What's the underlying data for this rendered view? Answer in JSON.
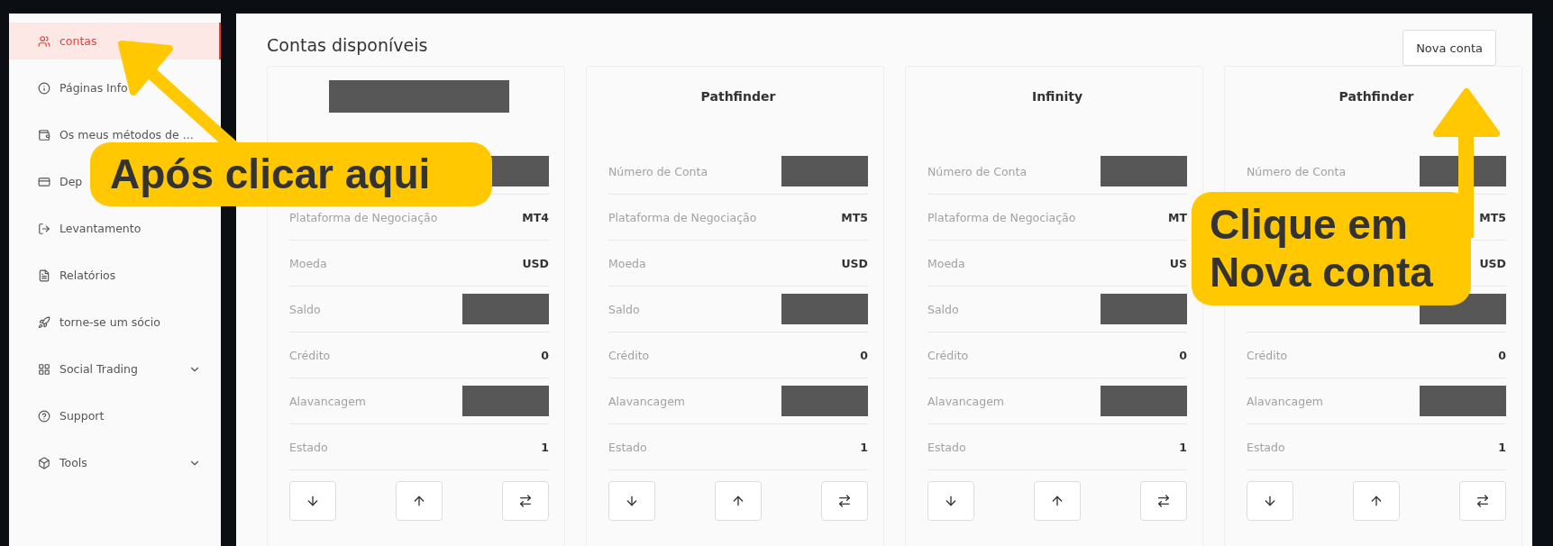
{
  "sidebar": {
    "items": [
      {
        "label": "contas",
        "selected": true,
        "has_submenu": false
      },
      {
        "label": "Páginas Info",
        "selected": false,
        "has_submenu": false
      },
      {
        "label": "Os meus métodos de ...",
        "selected": false,
        "has_submenu": false
      },
      {
        "label": "Dep",
        "selected": false,
        "has_submenu": false
      },
      {
        "label": "Levantamento",
        "selected": false,
        "has_submenu": false
      },
      {
        "label": "Relatórios",
        "selected": false,
        "has_submenu": false
      },
      {
        "label": "torne-se um sócio",
        "selected": false,
        "has_submenu": false
      },
      {
        "label": "Social Trading",
        "selected": false,
        "has_submenu": true
      },
      {
        "label": "Support",
        "selected": false,
        "has_submenu": false
      },
      {
        "label": "Tools",
        "selected": false,
        "has_submenu": true
      }
    ]
  },
  "main": {
    "title": "Contas disponíveis",
    "new_account_button": "Nova conta",
    "cards": [
      {
        "title_redacted": true,
        "rows": [
          {
            "kind": "redacted"
          },
          {
            "kind": "value",
            "label": "Plataforma de Negociação",
            "value": "MT4"
          },
          {
            "kind": "value",
            "label": "Moeda",
            "value": "USD"
          },
          {
            "kind": "redacted",
            "label": "Saldo"
          },
          {
            "kind": "value",
            "label": "Crédito",
            "value": "0"
          },
          {
            "kind": "redacted",
            "label": "Alavancagem"
          },
          {
            "kind": "value",
            "label": "Estado",
            "value": "1"
          }
        ]
      },
      {
        "title_redacted": false,
        "title": "Pathfinder",
        "rows": [
          {
            "kind": "redacted",
            "label": "Número de Conta"
          },
          {
            "kind": "value",
            "label": "Plataforma de Negociação",
            "value": "MT5"
          },
          {
            "kind": "value",
            "label": "Moeda",
            "value": "USD"
          },
          {
            "kind": "redacted",
            "label": "Saldo"
          },
          {
            "kind": "value",
            "label": "Crédito",
            "value": "0"
          },
          {
            "kind": "redacted",
            "label": "Alavancagem"
          },
          {
            "kind": "value",
            "label": "Estado",
            "value": "1"
          }
        ]
      },
      {
        "title_redacted": false,
        "title": "Infinity",
        "rows": [
          {
            "kind": "redacted",
            "label": "Número de Conta"
          },
          {
            "kind": "value",
            "label": "Plataforma de Negociação",
            "value": "MT"
          },
          {
            "kind": "value",
            "label": "Moeda",
            "value": "US"
          },
          {
            "kind": "redacted",
            "label": "Saldo"
          },
          {
            "kind": "value",
            "label": "Crédito",
            "value": "0"
          },
          {
            "kind": "redacted",
            "label": "Alavancagem"
          },
          {
            "kind": "value",
            "label": "Estado",
            "value": "1"
          }
        ]
      },
      {
        "title_redacted": false,
        "title": "Pathfinder",
        "rows": [
          {
            "kind": "redacted",
            "label": "Número de Conta"
          },
          {
            "kind": "value",
            "value": "MT5"
          },
          {
            "kind": "value",
            "value": "USD"
          },
          {
            "kind": "redacted"
          },
          {
            "kind": "value",
            "label": "Crédito",
            "value": "0"
          },
          {
            "kind": "redacted",
            "label": "Alavancagem"
          },
          {
            "kind": "value",
            "label": "Estado",
            "value": "1"
          }
        ]
      }
    ]
  },
  "callouts": [
    {
      "text": "Após clicar aqui"
    },
    {
      "text": "Clique em Nova conta"
    }
  ]
}
